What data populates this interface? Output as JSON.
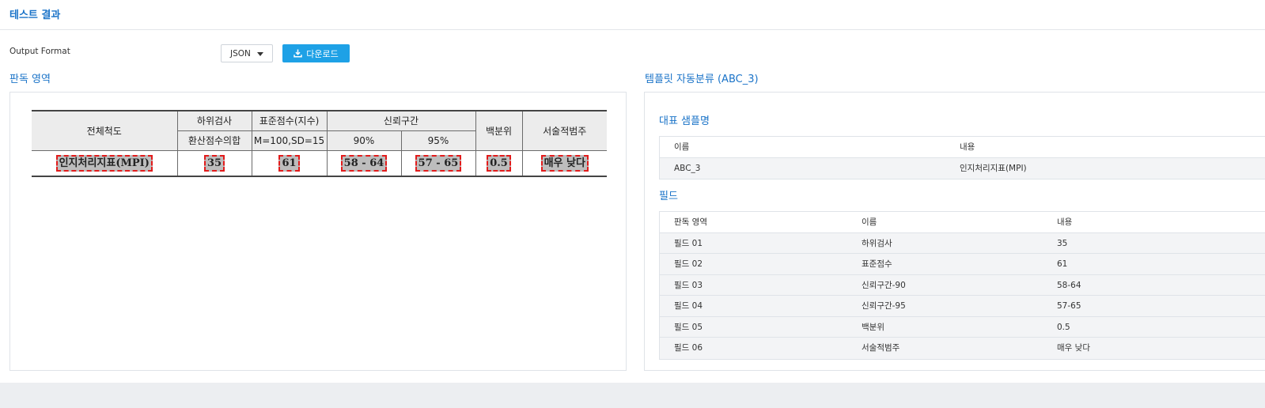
{
  "header": {
    "title": "테스트 결과"
  },
  "output": {
    "label": "Output Format",
    "format_value": "JSON",
    "download_label": "다운로드"
  },
  "left_panel": {
    "title": "판독 영역",
    "doc": {
      "h_total": "전체척도",
      "h_sub1": "하위검사",
      "h_sub2": "환산점수의합",
      "h_std1": "표준점수(지수)",
      "h_std2": "M=100,SD=15",
      "h_ci": "신뢰구간",
      "h_ci90": "90%",
      "h_ci95": "95%",
      "h_pct": "백분위",
      "h_desc": "서술적범주",
      "v_total": "인지처리지표(MPI)",
      "v_sub": "35",
      "v_std": "61",
      "v_ci90": "58 - 64",
      "v_ci95": "57 - 65",
      "v_pct": "0.5",
      "v_desc": "매우 낮다"
    }
  },
  "right_panel": {
    "title": "템플릿 자동분류 (ABC_3)",
    "sample": {
      "title": "대표 샘플명",
      "col_name": "이름",
      "col_content": "내용",
      "rows": [
        {
          "name": "ABC_3",
          "content": "인지처리지표(MPI)"
        }
      ]
    },
    "fields": {
      "title": "필드",
      "col_area": "판독 영역",
      "col_name": "이름",
      "col_content": "내용",
      "rows": [
        {
          "area": "필드 01",
          "name": "하위검사",
          "content": "35"
        },
        {
          "area": "필드 02",
          "name": "표준점수",
          "content": "61"
        },
        {
          "area": "필드 03",
          "name": "신뢰구간-90",
          "content": "58-64"
        },
        {
          "area": "필드 04",
          "name": "신뢰구간-95",
          "content": "57-65"
        },
        {
          "area": "필드 05",
          "name": "백분위",
          "content": "0.5"
        },
        {
          "area": "필드 06",
          "name": "서술적범주",
          "content": "매우 낮다"
        }
      ]
    }
  },
  "colors": {
    "accent": "#1a73c8",
    "button": "#1ea1e6",
    "highlight_border": "#e21b1b"
  },
  "icons": {
    "download": "download-icon",
    "dropdown": "caret-down-icon"
  }
}
